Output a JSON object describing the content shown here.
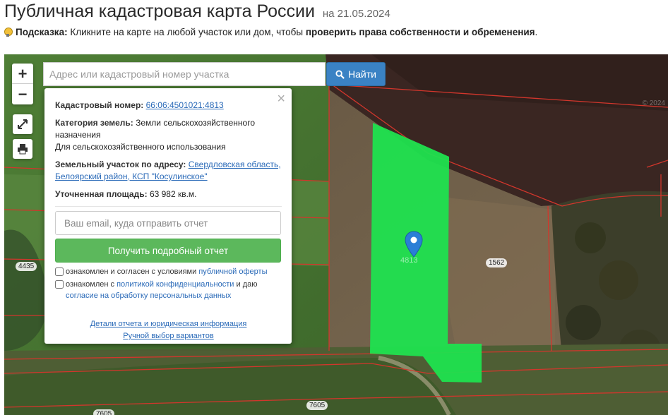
{
  "header": {
    "title": "Публичная кадастровая карта России",
    "date": "на 21.05.2024"
  },
  "hint": {
    "label": "Подсказка:",
    "text_before": " Кликните на карте на любой участок или дом, чтобы ",
    "text_bold": "проверить права собственности и обременения",
    "text_after": "."
  },
  "map": {
    "zoom_in": "+",
    "zoom_out": "−",
    "search": {
      "placeholder": "Адрес или кадастровый номер участка",
      "button_label": "Найти"
    },
    "labels": {
      "l4435": "4435",
      "l1562": "1562",
      "l4813": "4813",
      "l7605a": "7605",
      "l7605b": "7605"
    },
    "colors": {
      "parcel": "#1fe24f",
      "boundary": "#d2362c",
      "search_button": "#3a82c4",
      "report_button": "#5cb85c"
    }
  },
  "popup": {
    "close": "×",
    "cadastral_label": "Кадастровый номер:",
    "cadastral_number": "66:06:4501021:4813",
    "category_label": "Категория земель:",
    "category_value": "Земли сельскохозяйственного назначения",
    "use_value": "Для сельскохозяйственного использования",
    "address_label": "Земельный участок по адресу:",
    "address_value": "Свердловская область, Белоярский район, КСП \"Косулинское\"",
    "area_label": "Уточненная площадь:",
    "area_value": "63 982 кв.м.",
    "email_placeholder": "Ваш email, куда отправить отчет",
    "report_button": "Получить подробный отчет",
    "consent1_text": "ознакомлен и согласен с условиями ",
    "consent1_link": "публичной оферты",
    "consent2_text": "ознакомлен с ",
    "consent2_link": "политикой конфиденциальности",
    "consent2_mid": " и даю",
    "consent2_link2": "согласие на обработку персональных данных",
    "details_link": "Детали отчета и юридическая информация",
    "manual_link": "Ручной выбор вариантов"
  }
}
